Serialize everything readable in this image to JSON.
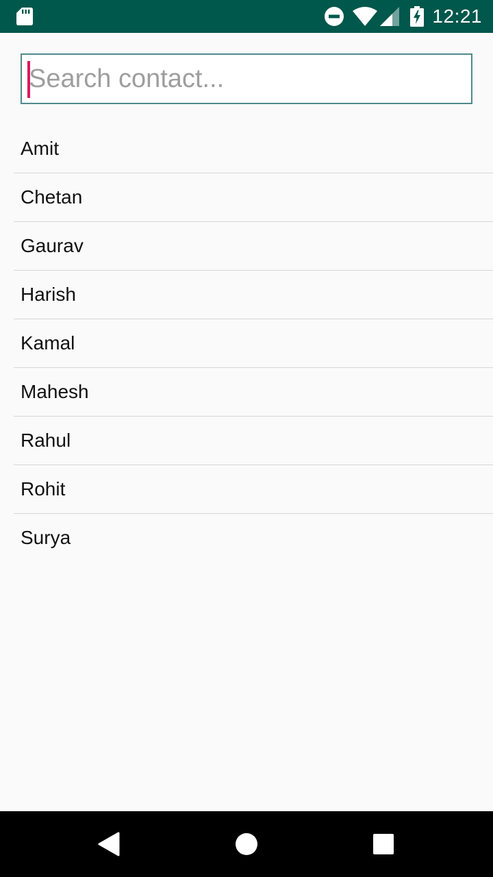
{
  "status_bar": {
    "time": "12:21",
    "icons": [
      "sd-card-icon",
      "do-not-disturb-icon",
      "wifi-icon",
      "cell-signal-icon",
      "battery-charging-icon"
    ]
  },
  "search": {
    "placeholder": "Search contact...",
    "value": ""
  },
  "contacts": [
    {
      "name": "Amit"
    },
    {
      "name": "Chetan"
    },
    {
      "name": "Gaurav"
    },
    {
      "name": "Harish"
    },
    {
      "name": "Kamal"
    },
    {
      "name": "Mahesh"
    },
    {
      "name": "Rahul"
    },
    {
      "name": "Rohit"
    },
    {
      "name": "Surya"
    }
  ],
  "nav_bar": {
    "buttons": [
      "back-icon",
      "home-icon",
      "recents-icon"
    ]
  },
  "colors": {
    "status_bar": "#00574b",
    "accent": "#d81b60",
    "search_border": "#4f8a8b",
    "background": "#fafafa"
  }
}
